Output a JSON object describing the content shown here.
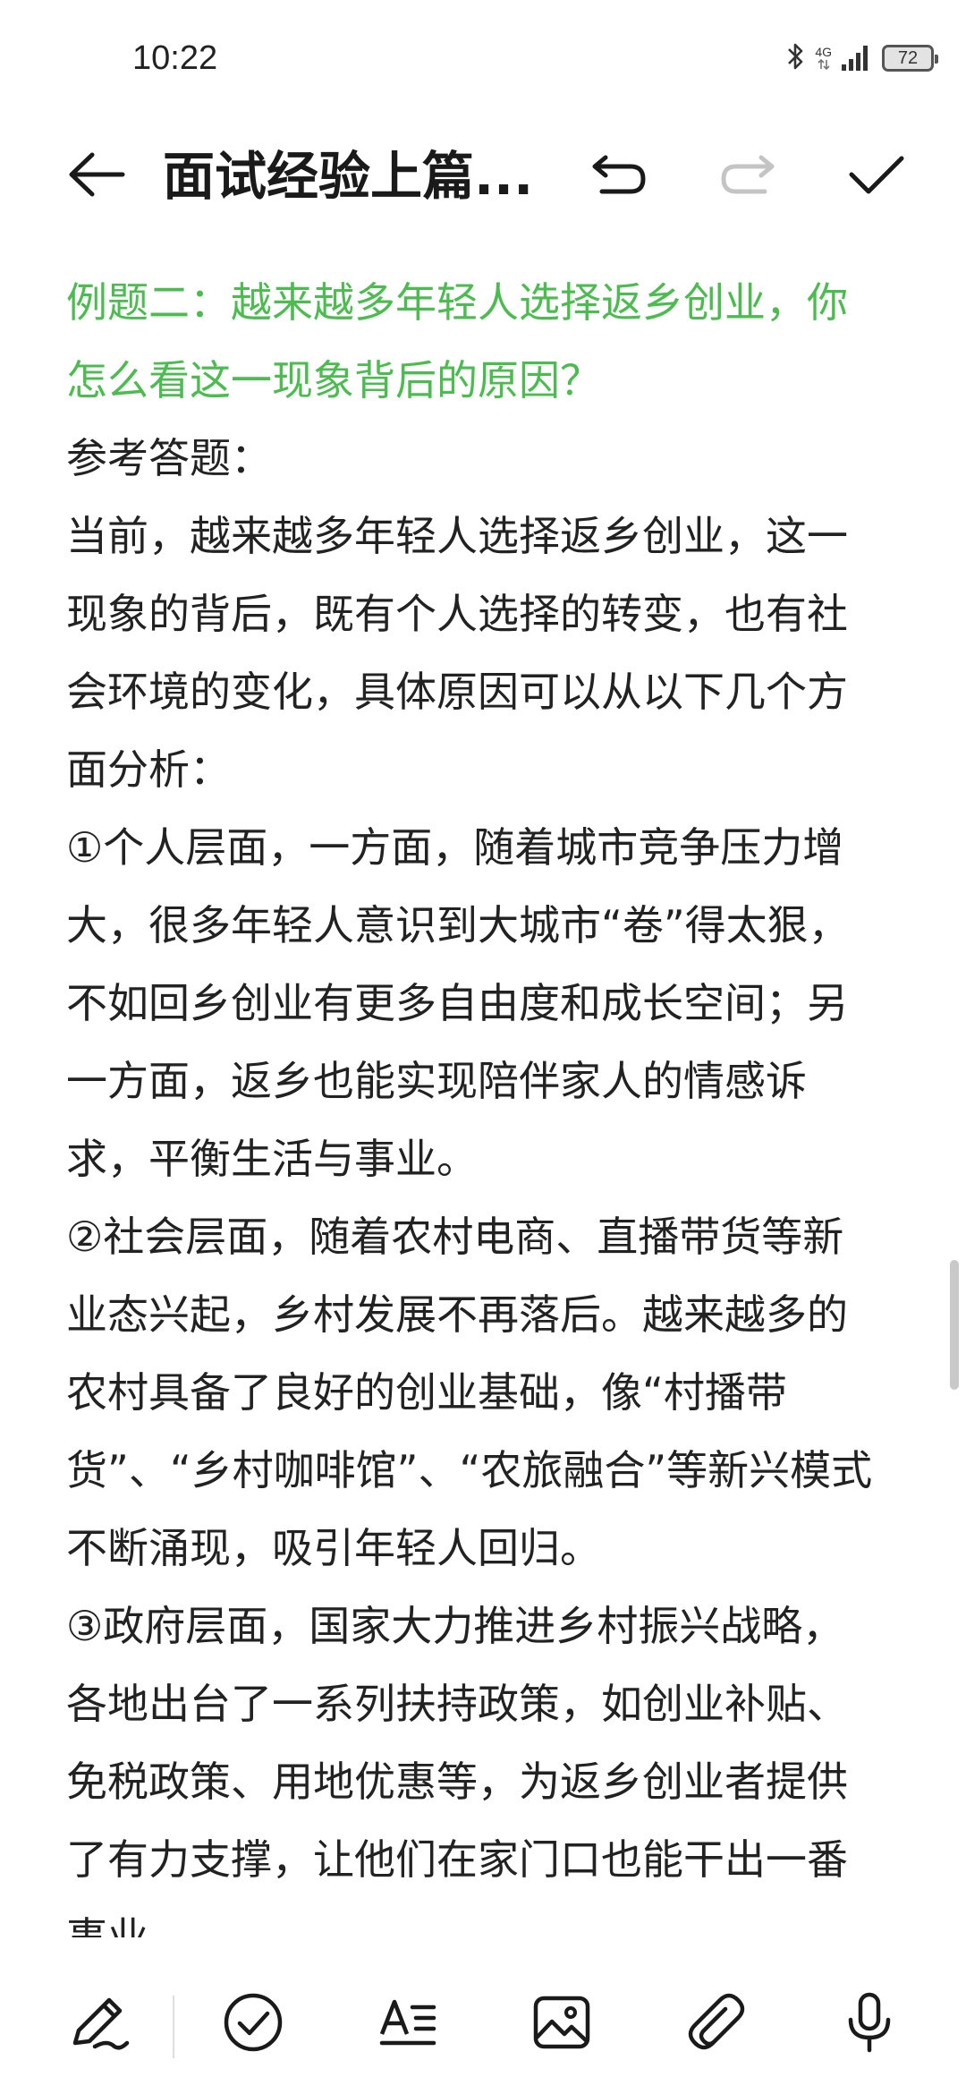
{
  "status_bar": {
    "time": "10:22",
    "network": "4G",
    "battery": "72",
    "icons": [
      "bluetooth-icon",
      "signal-icon",
      "battery-icon"
    ]
  },
  "toolbar": {
    "title": "面试经验上篇...",
    "back_icon": "arrow-left-icon",
    "undo_icon": "undo-icon",
    "redo_icon": "redo-icon",
    "done_icon": "check-icon"
  },
  "content": {
    "question_color": "#4cbb50",
    "lines": [
      "例题二：越来越多年轻人选择返乡创业，你",
      "怎么看这一现象背后的原因？",
      "参考答题：",
      "当前，越来越多年轻人选择返乡创业，这一",
      "现象的背后，既有个人选择的转变，也有社",
      "会环境的变化，具体原因可以从以下几个方",
      "面分析：",
      "①个人层面，一方面，随着城市竞争压力增",
      "大，很多年轻人意识到大城市“卷”得太狠，",
      "不如回乡创业有更多自由度和成长空间；另",
      "一方面，返乡也能实现陪伴家人的情感诉",
      "求，平衡生活与事业。",
      "②社会层面，随着农村电商、直播带货等新",
      "业态兴起，乡村发展不再落后。越来越多的",
      "农村具备了良好的创业基础，像“村播带",
      "货”、“乡村咖啡馆”、“农旅融合”等新兴模式",
      "不断涌现，吸引年轻人回归。",
      "③政府层面，国家大力推进乡村振兴战略，",
      "各地出台了一系列扶持政策，如创业补贴、",
      "免税政策、用地优惠等，为返乡创业者提供",
      "了有力支撑，让他们在家门口也能干出一番",
      "事业。"
    ]
  },
  "bottom_bar": {
    "tools": [
      "pen-icon",
      "checkbox-icon",
      "text-format-icon",
      "image-icon",
      "attachment-icon",
      "microphone-icon"
    ]
  }
}
